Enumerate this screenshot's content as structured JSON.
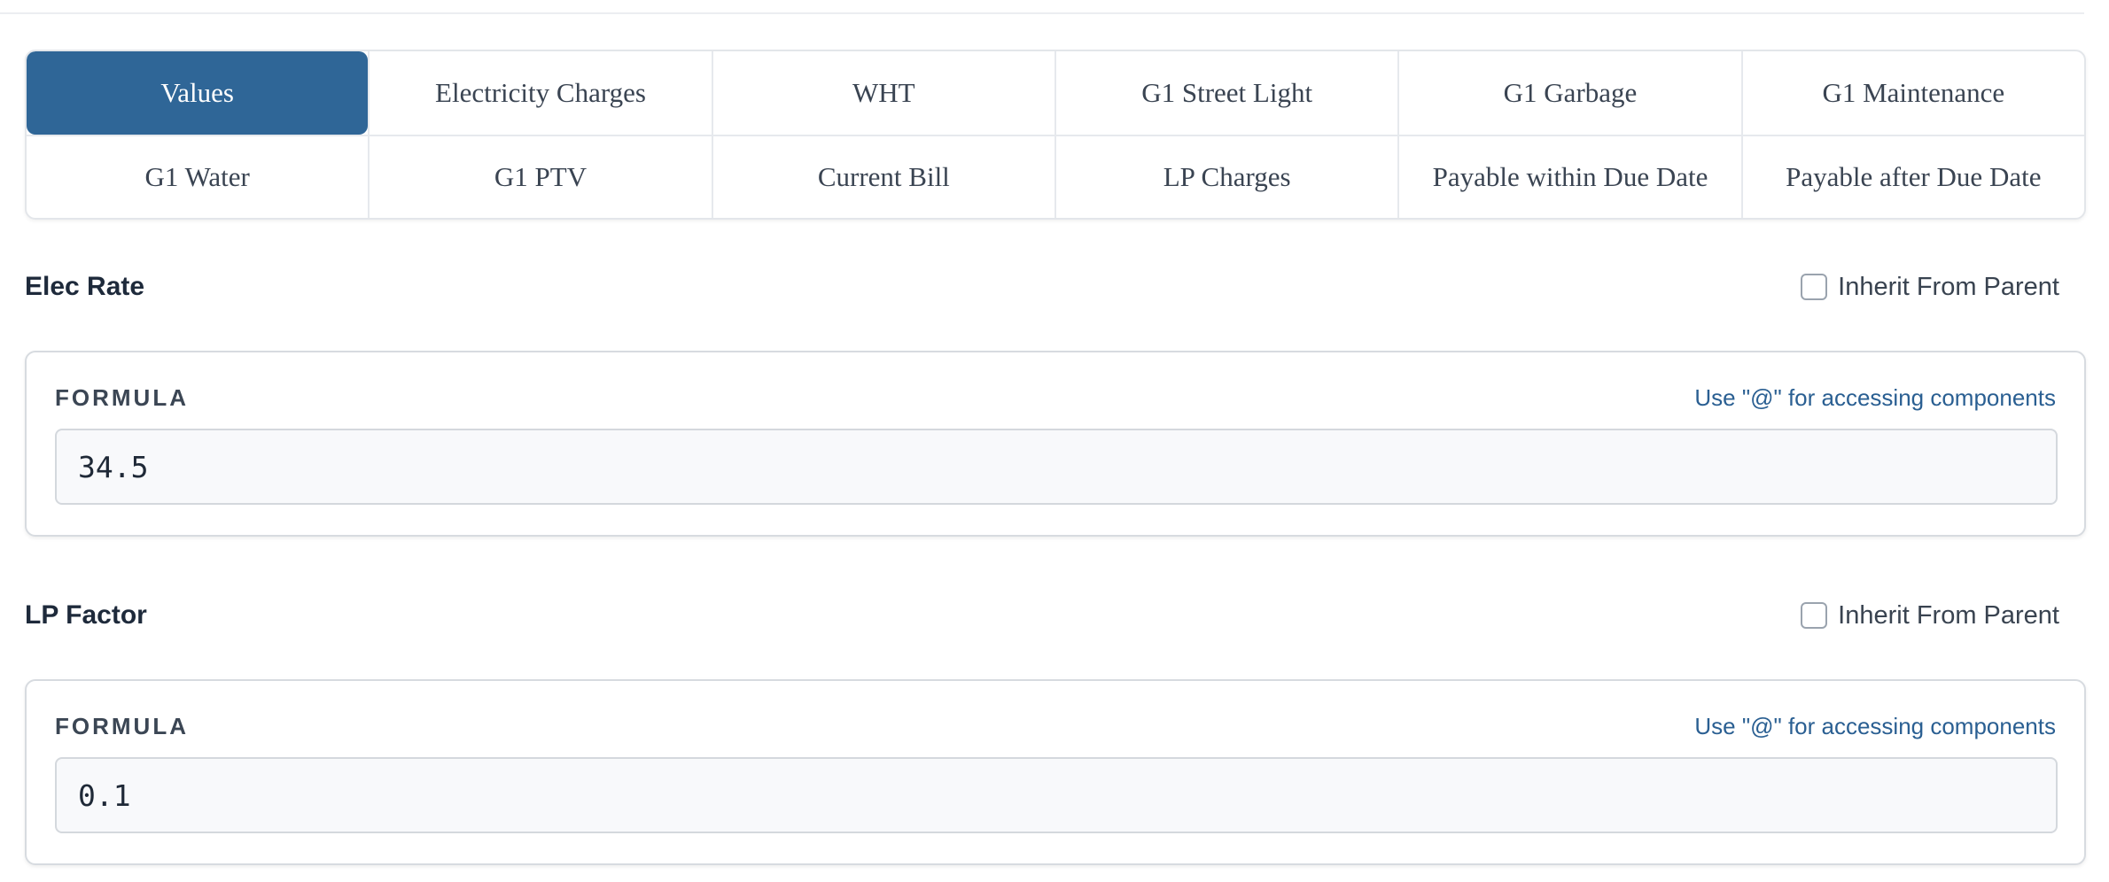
{
  "tabs": {
    "row1": [
      {
        "label": "Values",
        "active": true
      },
      {
        "label": "Electricity Charges"
      },
      {
        "label": "WHT"
      },
      {
        "label": "G1 Street Light"
      },
      {
        "label": "G1 Garbage"
      },
      {
        "label": "G1 Maintenance"
      }
    ],
    "row2": [
      {
        "label": "G1 Water"
      },
      {
        "label": "G1 PTV"
      },
      {
        "label": "Current Bill"
      },
      {
        "label": "LP Charges"
      },
      {
        "label": "Payable within Due Date"
      },
      {
        "label": "Payable after Due Date"
      }
    ]
  },
  "fields": [
    {
      "title": "Elec Rate",
      "inherit_label": "Inherit From Parent",
      "inherit_checked": false,
      "formula_label": "FORMULA",
      "formula_hint": "Use \"@\" for accessing components",
      "formula_value": "34.5"
    },
    {
      "title": "LP Factor",
      "inherit_label": "Inherit From Parent",
      "inherit_checked": false,
      "formula_label": "FORMULA",
      "formula_hint": "Use \"@\" for accessing components",
      "formula_value": "0.1"
    }
  ],
  "colors": {
    "accent": "#2f6697",
    "hint_link": "#2a5f92",
    "border": "#d7dbe0"
  }
}
